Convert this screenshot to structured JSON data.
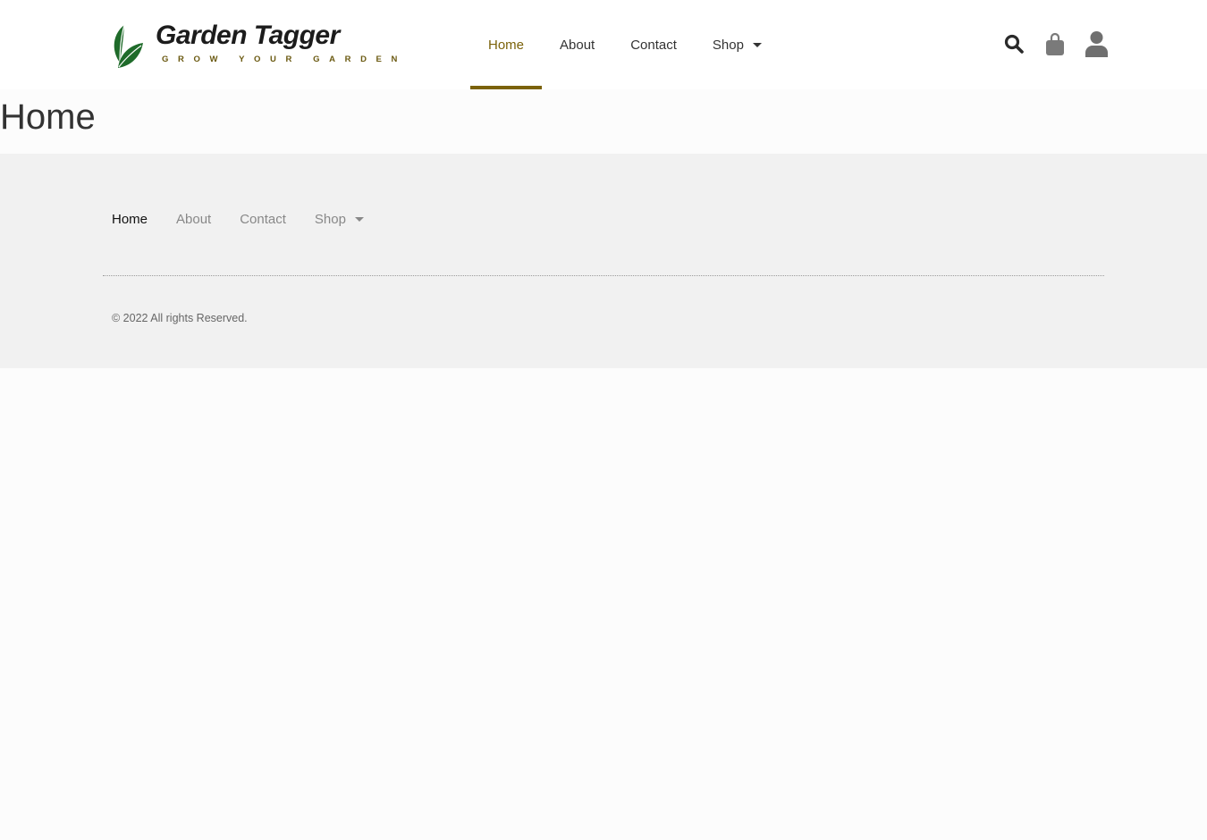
{
  "brand": {
    "name": "Garden Tagger",
    "tagline": "GROW YOUR GARDEN",
    "accent_color": "#7b6209",
    "leaf_color": "#1f6b2a"
  },
  "header": {
    "nav": [
      {
        "label": "Home",
        "active": true
      },
      {
        "label": "About",
        "active": false
      },
      {
        "label": "Contact",
        "active": false
      },
      {
        "label": "Shop",
        "active": false,
        "has_dropdown": true
      }
    ],
    "icons": [
      "search-icon",
      "shopping-bag-icon",
      "user-icon"
    ]
  },
  "page": {
    "title": "Home"
  },
  "footer": {
    "nav": [
      {
        "label": "Home",
        "active": true
      },
      {
        "label": "About",
        "active": false
      },
      {
        "label": "Contact",
        "active": false
      },
      {
        "label": "Shop",
        "active": false,
        "has_dropdown": true
      }
    ],
    "copyright": "© 2022 All rights Reserved."
  }
}
